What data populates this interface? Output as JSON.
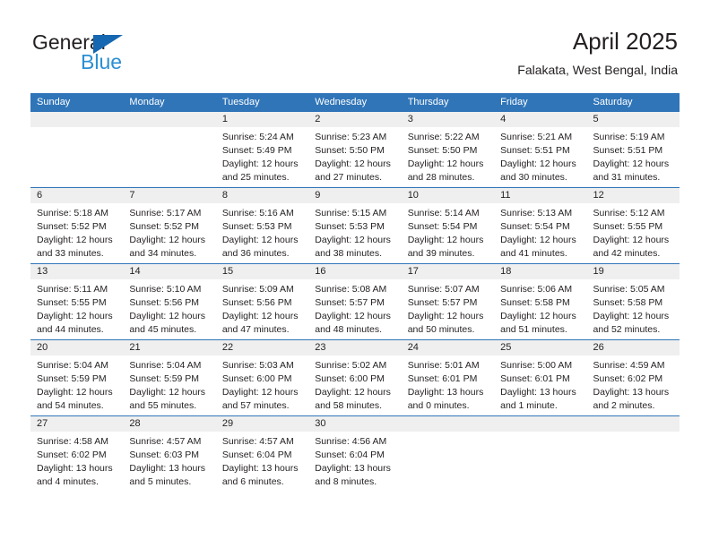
{
  "brand": {
    "name_part1": "General",
    "name_part2": "Blue",
    "triangle_icon": "blue-triangle-icon",
    "accent_blue": "#1667b1",
    "light_blue": "#2a8fd4"
  },
  "header": {
    "title": "April 2025",
    "subtitle": "Falakata, West Bengal, India"
  },
  "theme": {
    "header_bg": "#3075b8",
    "daynum_bg": "#efefef",
    "text": "#231f20"
  },
  "weekday_headers": [
    "Sunday",
    "Monday",
    "Tuesday",
    "Wednesday",
    "Thursday",
    "Friday",
    "Saturday"
  ],
  "weeks": [
    [
      {
        "day": "",
        "sunrise": "",
        "sunset": "",
        "daylight_line1": "",
        "daylight_line2": ""
      },
      {
        "day": "",
        "sunrise": "",
        "sunset": "",
        "daylight_line1": "",
        "daylight_line2": ""
      },
      {
        "day": "1",
        "sunrise": "Sunrise: 5:24 AM",
        "sunset": "Sunset: 5:49 PM",
        "daylight_line1": "Daylight: 12 hours",
        "daylight_line2": "and 25 minutes."
      },
      {
        "day": "2",
        "sunrise": "Sunrise: 5:23 AM",
        "sunset": "Sunset: 5:50 PM",
        "daylight_line1": "Daylight: 12 hours",
        "daylight_line2": "and 27 minutes."
      },
      {
        "day": "3",
        "sunrise": "Sunrise: 5:22 AM",
        "sunset": "Sunset: 5:50 PM",
        "daylight_line1": "Daylight: 12 hours",
        "daylight_line2": "and 28 minutes."
      },
      {
        "day": "4",
        "sunrise": "Sunrise: 5:21 AM",
        "sunset": "Sunset: 5:51 PM",
        "daylight_line1": "Daylight: 12 hours",
        "daylight_line2": "and 30 minutes."
      },
      {
        "day": "5",
        "sunrise": "Sunrise: 5:19 AM",
        "sunset": "Sunset: 5:51 PM",
        "daylight_line1": "Daylight: 12 hours",
        "daylight_line2": "and 31 minutes."
      }
    ],
    [
      {
        "day": "6",
        "sunrise": "Sunrise: 5:18 AM",
        "sunset": "Sunset: 5:52 PM",
        "daylight_line1": "Daylight: 12 hours",
        "daylight_line2": "and 33 minutes."
      },
      {
        "day": "7",
        "sunrise": "Sunrise: 5:17 AM",
        "sunset": "Sunset: 5:52 PM",
        "daylight_line1": "Daylight: 12 hours",
        "daylight_line2": "and 34 minutes."
      },
      {
        "day": "8",
        "sunrise": "Sunrise: 5:16 AM",
        "sunset": "Sunset: 5:53 PM",
        "daylight_line1": "Daylight: 12 hours",
        "daylight_line2": "and 36 minutes."
      },
      {
        "day": "9",
        "sunrise": "Sunrise: 5:15 AM",
        "sunset": "Sunset: 5:53 PM",
        "daylight_line1": "Daylight: 12 hours",
        "daylight_line2": "and 38 minutes."
      },
      {
        "day": "10",
        "sunrise": "Sunrise: 5:14 AM",
        "sunset": "Sunset: 5:54 PM",
        "daylight_line1": "Daylight: 12 hours",
        "daylight_line2": "and 39 minutes."
      },
      {
        "day": "11",
        "sunrise": "Sunrise: 5:13 AM",
        "sunset": "Sunset: 5:54 PM",
        "daylight_line1": "Daylight: 12 hours",
        "daylight_line2": "and 41 minutes."
      },
      {
        "day": "12",
        "sunrise": "Sunrise: 5:12 AM",
        "sunset": "Sunset: 5:55 PM",
        "daylight_line1": "Daylight: 12 hours",
        "daylight_line2": "and 42 minutes."
      }
    ],
    [
      {
        "day": "13",
        "sunrise": "Sunrise: 5:11 AM",
        "sunset": "Sunset: 5:55 PM",
        "daylight_line1": "Daylight: 12 hours",
        "daylight_line2": "and 44 minutes."
      },
      {
        "day": "14",
        "sunrise": "Sunrise: 5:10 AM",
        "sunset": "Sunset: 5:56 PM",
        "daylight_line1": "Daylight: 12 hours",
        "daylight_line2": "and 45 minutes."
      },
      {
        "day": "15",
        "sunrise": "Sunrise: 5:09 AM",
        "sunset": "Sunset: 5:56 PM",
        "daylight_line1": "Daylight: 12 hours",
        "daylight_line2": "and 47 minutes."
      },
      {
        "day": "16",
        "sunrise": "Sunrise: 5:08 AM",
        "sunset": "Sunset: 5:57 PM",
        "daylight_line1": "Daylight: 12 hours",
        "daylight_line2": "and 48 minutes."
      },
      {
        "day": "17",
        "sunrise": "Sunrise: 5:07 AM",
        "sunset": "Sunset: 5:57 PM",
        "daylight_line1": "Daylight: 12 hours",
        "daylight_line2": "and 50 minutes."
      },
      {
        "day": "18",
        "sunrise": "Sunrise: 5:06 AM",
        "sunset": "Sunset: 5:58 PM",
        "daylight_line1": "Daylight: 12 hours",
        "daylight_line2": "and 51 minutes."
      },
      {
        "day": "19",
        "sunrise": "Sunrise: 5:05 AM",
        "sunset": "Sunset: 5:58 PM",
        "daylight_line1": "Daylight: 12 hours",
        "daylight_line2": "and 52 minutes."
      }
    ],
    [
      {
        "day": "20",
        "sunrise": "Sunrise: 5:04 AM",
        "sunset": "Sunset: 5:59 PM",
        "daylight_line1": "Daylight: 12 hours",
        "daylight_line2": "and 54 minutes."
      },
      {
        "day": "21",
        "sunrise": "Sunrise: 5:04 AM",
        "sunset": "Sunset: 5:59 PM",
        "daylight_line1": "Daylight: 12 hours",
        "daylight_line2": "and 55 minutes."
      },
      {
        "day": "22",
        "sunrise": "Sunrise: 5:03 AM",
        "sunset": "Sunset: 6:00 PM",
        "daylight_line1": "Daylight: 12 hours",
        "daylight_line2": "and 57 minutes."
      },
      {
        "day": "23",
        "sunrise": "Sunrise: 5:02 AM",
        "sunset": "Sunset: 6:00 PM",
        "daylight_line1": "Daylight: 12 hours",
        "daylight_line2": "and 58 minutes."
      },
      {
        "day": "24",
        "sunrise": "Sunrise: 5:01 AM",
        "sunset": "Sunset: 6:01 PM",
        "daylight_line1": "Daylight: 13 hours",
        "daylight_line2": "and 0 minutes."
      },
      {
        "day": "25",
        "sunrise": "Sunrise: 5:00 AM",
        "sunset": "Sunset: 6:01 PM",
        "daylight_line1": "Daylight: 13 hours",
        "daylight_line2": "and 1 minute."
      },
      {
        "day": "26",
        "sunrise": "Sunrise: 4:59 AM",
        "sunset": "Sunset: 6:02 PM",
        "daylight_line1": "Daylight: 13 hours",
        "daylight_line2": "and 2 minutes."
      }
    ],
    [
      {
        "day": "27",
        "sunrise": "Sunrise: 4:58 AM",
        "sunset": "Sunset: 6:02 PM",
        "daylight_line1": "Daylight: 13 hours",
        "daylight_line2": "and 4 minutes."
      },
      {
        "day": "28",
        "sunrise": "Sunrise: 4:57 AM",
        "sunset": "Sunset: 6:03 PM",
        "daylight_line1": "Daylight: 13 hours",
        "daylight_line2": "and 5 minutes."
      },
      {
        "day": "29",
        "sunrise": "Sunrise: 4:57 AM",
        "sunset": "Sunset: 6:04 PM",
        "daylight_line1": "Daylight: 13 hours",
        "daylight_line2": "and 6 minutes."
      },
      {
        "day": "30",
        "sunrise": "Sunrise: 4:56 AM",
        "sunset": "Sunset: 6:04 PM",
        "daylight_line1": "Daylight: 13 hours",
        "daylight_line2": "and 8 minutes."
      },
      {
        "day": "",
        "sunrise": "",
        "sunset": "",
        "daylight_line1": "",
        "daylight_line2": ""
      },
      {
        "day": "",
        "sunrise": "",
        "sunset": "",
        "daylight_line1": "",
        "daylight_line2": ""
      },
      {
        "day": "",
        "sunrise": "",
        "sunset": "",
        "daylight_line1": "",
        "daylight_line2": ""
      }
    ]
  ]
}
